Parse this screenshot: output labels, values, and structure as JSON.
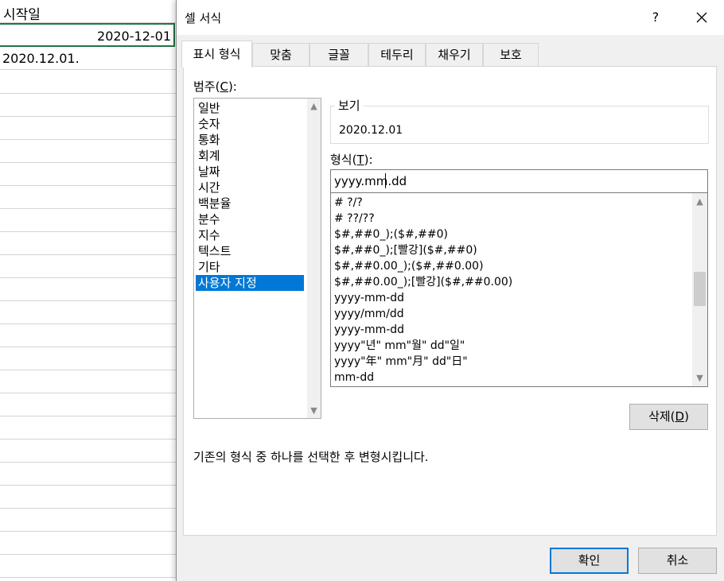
{
  "spreadsheet": {
    "header_cell": "시작일",
    "date_cell": "2020-12-01",
    "text_cell": "2020.12.01."
  },
  "dialog": {
    "title": "셀 서식",
    "help": "?",
    "tabs": [
      {
        "label": "표시 형식",
        "active": true
      },
      {
        "label": "맞춤"
      },
      {
        "label": "글꼴"
      },
      {
        "label": "테두리"
      },
      {
        "label": "채우기"
      },
      {
        "label": "보호"
      }
    ],
    "category_label": "범주(",
    "category_hotkey": "C",
    "category_label_end": "):",
    "categories": [
      "일반",
      "숫자",
      "통화",
      "회계",
      "날짜",
      "시간",
      "백분율",
      "분수",
      "지수",
      "텍스트",
      "기타",
      "사용자 지정"
    ],
    "selected_category": "사용자 지정",
    "sample_label": "보기",
    "sample_value": "2020.12.01",
    "format_label": "형식(",
    "format_hotkey": "T",
    "format_label_end": "):",
    "format_value": "yyyy.mm.dd",
    "format_list": [
      "# ?/?",
      "# ??/??",
      "$#,##0_);($#,##0)",
      "$#,##0_);[빨강]($#,##0)",
      "$#,##0.00_);($#,##0.00)",
      "$#,##0.00_);[빨강]($#,##0.00)",
      "yyyy-mm-dd",
      "yyyy/mm/dd",
      "yyyy-mm-dd",
      "yyyy\"년\" mm\"월\" dd\"일\"",
      "yyyy\"年\" mm\"月\" dd\"日\"",
      "mm-dd"
    ],
    "delete_label": "삭제(",
    "delete_hotkey": "D",
    "delete_label_end": ")",
    "description": "기존의 형식 중 하나를 선택한 후 변형시킵니다.",
    "ok_label": "확인",
    "cancel_label": "취소"
  },
  "colors": {
    "selection": "#0078d7",
    "cell_border": "#217346"
  },
  "icons": [
    "close-icon",
    "scroll-up-arrow-icon",
    "scroll-down-arrow-icon"
  ]
}
